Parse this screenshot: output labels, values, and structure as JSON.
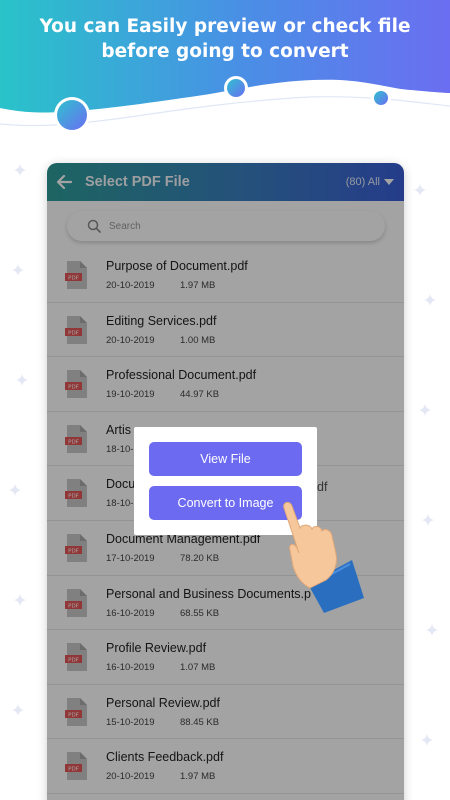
{
  "banner": {
    "line1": "You can Easily preview or check file",
    "line2": "before going to convert"
  },
  "app": {
    "title": "Select PDF File",
    "count": "(80) All",
    "search_placeholder": "Search",
    "file_icon_label": "PDF",
    "files": [
      {
        "name": "Purpose of Document.pdf",
        "date": "20-10-2019",
        "size": "1.97 MB"
      },
      {
        "name": "Editing Services.pdf",
        "date": "20-10-2019",
        "size": "1.00 MB"
      },
      {
        "name": "Professional Document.pdf",
        "date": "19-10-2019",
        "size": "44.97 KB"
      },
      {
        "name": "Artis",
        "date": "18-10-",
        "size": ""
      },
      {
        "name": "Docu",
        "date": "18-10-",
        "size": ""
      },
      {
        "name": "Document Management.pdf",
        "date": "17-10-2019",
        "size": "78.20 KB"
      },
      {
        "name": "Personal and Business Documents.p",
        "date": "16-10-2019",
        "size": "68.55 KB"
      },
      {
        "name": "Profile Review.pdf",
        "date": "16-10-2019",
        "size": "1.07 MB"
      },
      {
        "name": "Personal Review.pdf",
        "date": "15-10-2019",
        "size": "88.45 KB"
      },
      {
        "name": "Clients Feedback.pdf",
        "date": "20-10-2019",
        "size": "1.97 MB"
      }
    ],
    "overflow_text": "df"
  },
  "popup": {
    "view_label": "View File",
    "convert_label": "Convert to Image"
  },
  "colors": {
    "accent": "#6c6af0",
    "bar_start": "#2e9e9a",
    "bar_end": "#3a5fd8"
  }
}
